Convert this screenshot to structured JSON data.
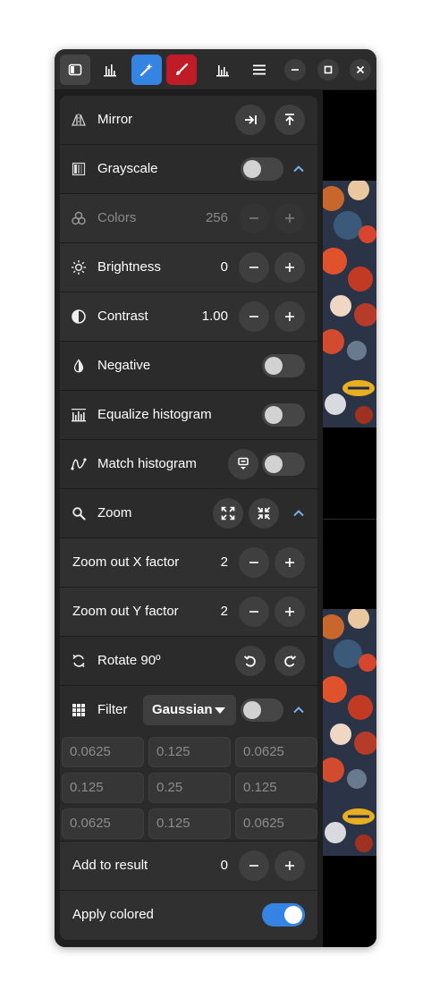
{
  "headerbar": {
    "buttons": [
      "sidebar-toggle",
      "histogram",
      "magic-wand",
      "brush",
      "histogram-view",
      "menu"
    ],
    "window_controls": [
      "minimize",
      "maximize",
      "close"
    ],
    "colors": {
      "blue": "#3584e4",
      "red": "#c01c28"
    }
  },
  "rows": {
    "mirror": {
      "label": "Mirror"
    },
    "grayscale": {
      "label": "Grayscale",
      "enabled": false
    },
    "colors": {
      "label": "Colors",
      "value": "256"
    },
    "brightness": {
      "label": "Brightness",
      "value": "0"
    },
    "contrast": {
      "label": "Contrast",
      "value": "1.00"
    },
    "negative": {
      "label": "Negative",
      "enabled": false
    },
    "equalize": {
      "label": "Equalize histogram",
      "enabled": false
    },
    "match": {
      "label": "Match histogram",
      "enabled": false
    },
    "zoom": {
      "label": "Zoom"
    },
    "zoom_x": {
      "label": "Zoom out X factor",
      "value": "2"
    },
    "zoom_y": {
      "label": "Zoom out Y factor",
      "value": "2"
    },
    "rotate": {
      "label": "Rotate 90º"
    },
    "filter": {
      "label": "Filter",
      "selected": "Gaussian",
      "enabled": false
    },
    "add_result": {
      "label": "Add to result",
      "value": "0"
    },
    "apply_colored": {
      "label": "Apply colored",
      "enabled": true
    }
  },
  "kernel": {
    "cells": [
      "0.0625",
      "0.125",
      "0.0625",
      "0.125",
      "0.25",
      "0.125",
      "0.0625",
      "0.125",
      "0.0625"
    ]
  }
}
